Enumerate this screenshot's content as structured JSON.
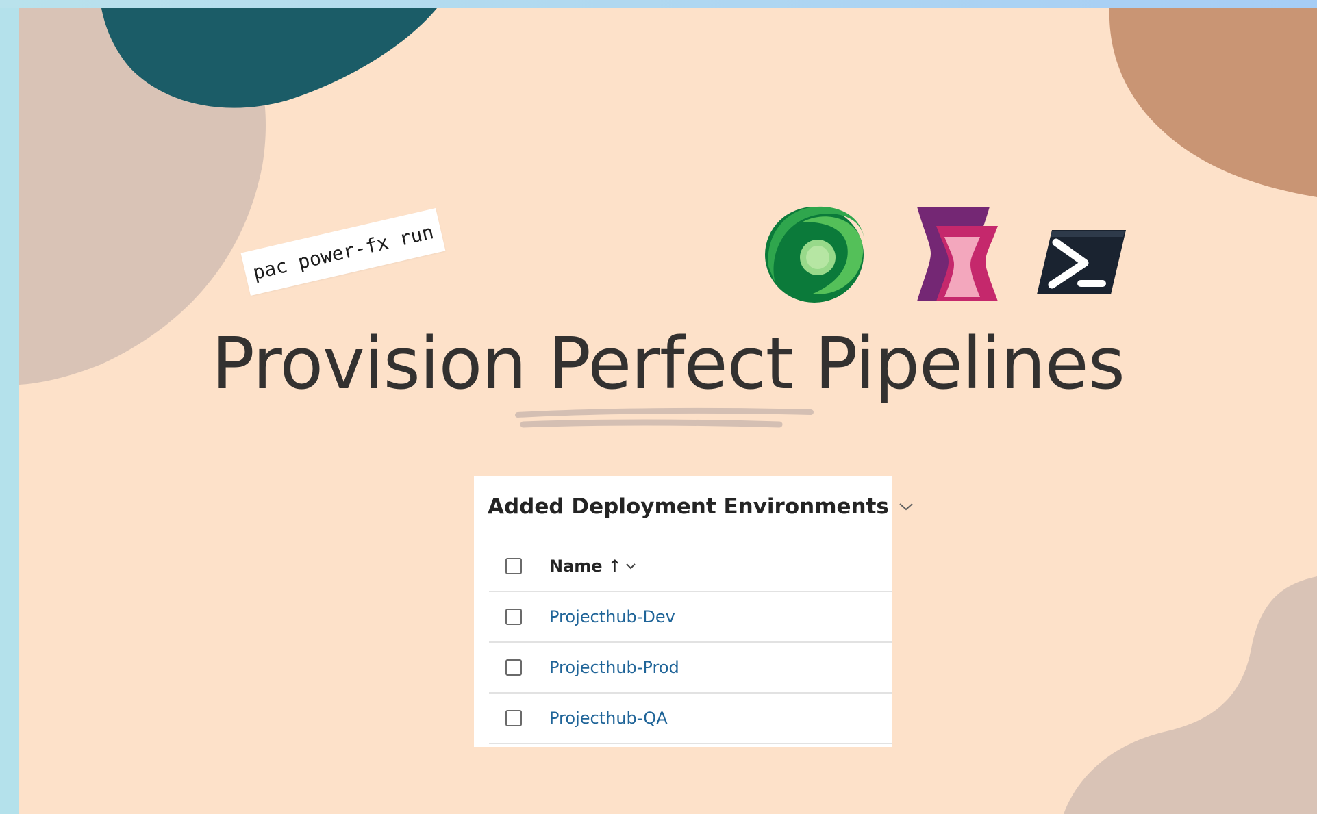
{
  "code_tag": {
    "text": "pac power-fx run"
  },
  "title": {
    "text": "Provision Perfect Pipelines"
  },
  "logos": {
    "dataverse": "dataverse-logo",
    "power_apps": "power-apps-logo",
    "powershell": "powershell-logo"
  },
  "panel": {
    "title": "Added Deployment Environments",
    "column_header": "Name",
    "sort_indicator": "↑",
    "rows": [
      {
        "name": "Projecthub-Dev"
      },
      {
        "name": "Projecthub-Prod"
      },
      {
        "name": "Projecthub-QA"
      }
    ]
  },
  "colors": {
    "background": "#fde1c9",
    "border_strip": "#b4e1eb",
    "blob_teal": "#1b5c67",
    "blob_tan": "#d9c3b6",
    "blob_copper": "#c99574",
    "title_text": "#333130",
    "link": "#1f6498"
  }
}
